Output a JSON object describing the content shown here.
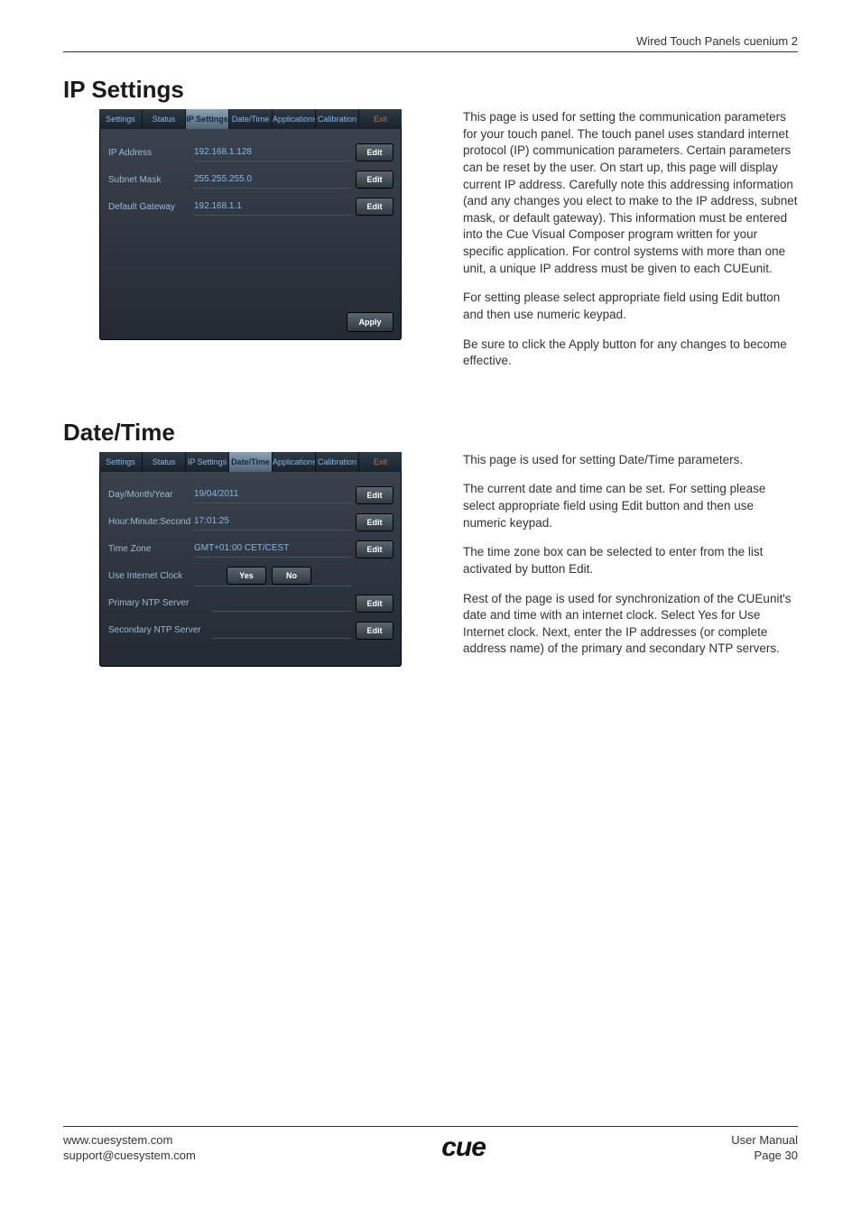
{
  "header": {
    "product": "Wired Touch Panels cuenium 2"
  },
  "ip": {
    "heading": "IP Settings",
    "tabs": [
      "Settings",
      "Status",
      "IP Settings",
      "Date/Time",
      "Applications",
      "Calibration",
      "Exit"
    ],
    "active_tab": 2,
    "rows": [
      {
        "label": "IP Address",
        "value": "192.168.1.128",
        "edit": "Edit"
      },
      {
        "label": "Subnet Mask",
        "value": "255.255.255.0",
        "edit": "Edit"
      },
      {
        "label": "Default Gateway",
        "value": "192.168.1.1",
        "edit": "Edit"
      }
    ],
    "apply": "Apply",
    "paragraphs": [
      "This page is used for setting the communication parameters for your touch panel. The touch panel uses standard internet protocol (IP) communication parameters. Certain parameters can be reset by the user. On start up, this page will display current IP address. Carefully note this addressing information (and any changes you elect to make to the IP address, subnet mask, or default gateway). This information must be entered into the Cue Visual Composer program written for your specific application. For control systems with more than one unit, a unique IP address must be given to each CUEunit.",
      "For setting please select appropriate field using Edit button and then use numeric keypad.",
      "Be sure to click the Apply button for any changes to become effective."
    ]
  },
  "dt": {
    "heading": "Date/Time",
    "tabs": [
      "Settings",
      "Status",
      "IP Settings",
      "Date/Time",
      "Applications",
      "Calibration",
      "Exit"
    ],
    "active_tab": 3,
    "rows": [
      {
        "label": "Day/Month/Year",
        "value": "19/04/2011",
        "edit": "Edit"
      },
      {
        "label": "Hour:Minute:Second",
        "value": "17:01:25",
        "edit": "Edit"
      },
      {
        "label": "Time Zone",
        "value": "GMT+01:00 CET/CEST",
        "edit": "Edit"
      }
    ],
    "use_internet": {
      "label": "Use Internet Clock",
      "yes": "Yes",
      "no": "No"
    },
    "ntp_rows": [
      {
        "label": "Primary NTP Server",
        "value": "",
        "edit": "Edit"
      },
      {
        "label": "Secondary NTP Server",
        "value": "",
        "edit": "Edit"
      }
    ],
    "paragraphs": [
      "This page is used for setting Date/Time parameters.",
      "The current date and time can be set. For setting please select appropriate field using Edit button and then use numeric keypad.",
      "The time zone box can be selected to enter from the list activated by button Edit.",
      "Rest of the page is used for synchronization of the CUEunit's date and time with an internet clock. Select Yes for Use Internet clock. Next, enter the IP addresses (or complete address name) of the primary and secondary NTP servers."
    ]
  },
  "footer": {
    "url": "www.cuesystem.com",
    "email": "support@cuesystem.com",
    "logo": "cue",
    "manual": "User Manual",
    "page": "Page 30"
  }
}
